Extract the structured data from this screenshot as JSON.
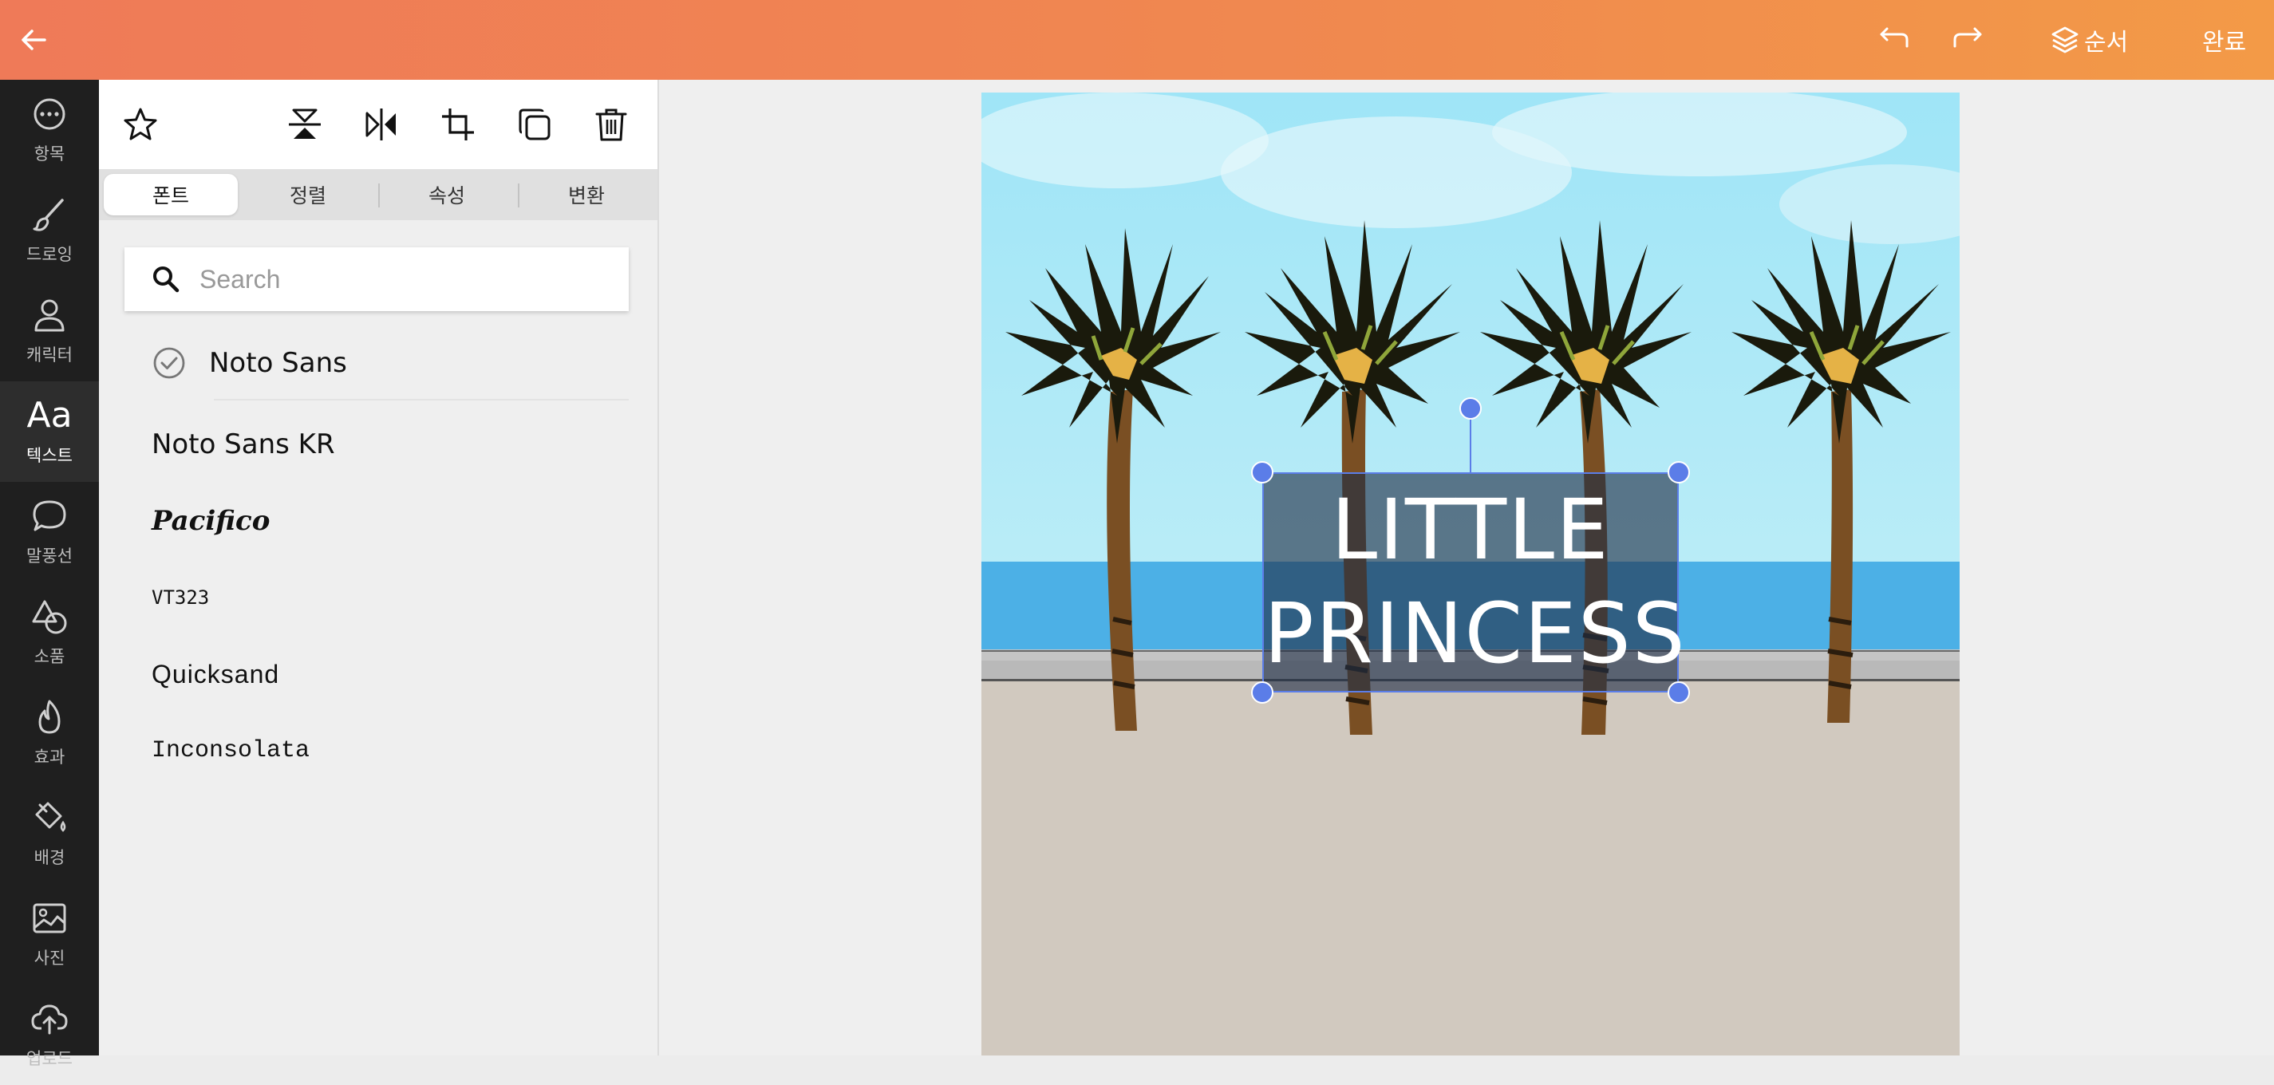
{
  "topbar": {
    "order_label": "순서",
    "done_label": "완료",
    "colors": {
      "gradient_start": "#ef7a58",
      "gradient_end": "#f39a47"
    }
  },
  "rail": {
    "items": [
      {
        "label": "항목",
        "icon": "more-icon"
      },
      {
        "label": "드로잉",
        "icon": "brush-icon"
      },
      {
        "label": "캐릭터",
        "icon": "person-icon"
      },
      {
        "label": "텍스트",
        "icon": "text-icon",
        "glyph": "Aa"
      },
      {
        "label": "말풍선",
        "icon": "speech-bubble-icon"
      },
      {
        "label": "소품",
        "icon": "shapes-icon"
      },
      {
        "label": "효과",
        "icon": "flame-icon"
      },
      {
        "label": "배경",
        "icon": "paint-bucket-icon"
      },
      {
        "label": "사진",
        "icon": "image-icon"
      },
      {
        "label": "업로드",
        "icon": "upload-icon"
      }
    ]
  },
  "panel": {
    "tabs": [
      "폰트",
      "정렬",
      "속성",
      "변환"
    ],
    "search_placeholder": "Search",
    "fonts": [
      {
        "name": "Noto Sans",
        "selected": true
      },
      {
        "name": "Noto Sans KR"
      },
      {
        "name": "Pacifico"
      },
      {
        "name": "VT323"
      },
      {
        "name": "Quicksand"
      },
      {
        "name": "Inconsolata"
      }
    ]
  },
  "canvas": {
    "text_lines": [
      "LITTLE",
      "PRINCESS"
    ],
    "colors": {
      "selection": "#5b7de8",
      "sky": "#a7e8f8",
      "sea": "#4cb0e6",
      "sand": "#d1c9bf"
    }
  }
}
